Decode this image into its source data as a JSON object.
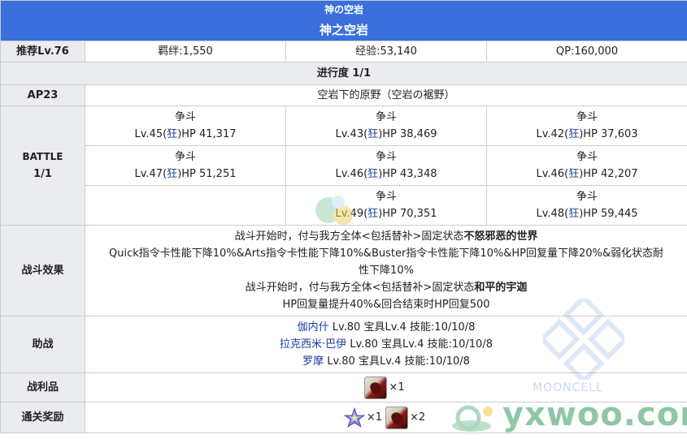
{
  "header": {
    "title_jp": "神の空岩",
    "title_cn": "神之空岩"
  },
  "recommend": {
    "level": "推荐Lv.76",
    "bond": "羁绊:1,550",
    "exp": "经验:53,140",
    "qp": "QP:160,000"
  },
  "progress": "进行度 1/1",
  "ap": {
    "label": "AP23",
    "location": "空岩下的原野（空岩の裾野）"
  },
  "battle": {
    "label_line1": "BATTLE",
    "label_line2": "1/1",
    "rows": [
      [
        {
          "name": "争斗",
          "lv": "Lv.45(",
          "cls": "狂",
          "hp": ")HP 41,317"
        },
        {
          "name": "争斗",
          "lv": "Lv.43(",
          "cls": "狂",
          "hp": ")HP 38,469"
        },
        {
          "name": "争斗",
          "lv": "Lv.42(",
          "cls": "狂",
          "hp": ")HP 37,603"
        }
      ],
      [
        {
          "name": "争斗",
          "lv": "Lv.47(",
          "cls": "狂",
          "hp": ")HP 51,251"
        },
        {
          "name": "争斗",
          "lv": "Lv.46(",
          "cls": "狂",
          "hp": ")HP 43,348"
        },
        {
          "name": "争斗",
          "lv": "Lv.46(",
          "cls": "狂",
          "hp": ")HP 42,207"
        }
      ],
      [
        {
          "name": "争斗",
          "lv": "Lv.49(",
          "cls": "狂",
          "hp": ")HP 70,351"
        },
        {
          "name": "争斗",
          "lv": "Lv.48(",
          "cls": "狂",
          "hp": ")HP 59,445"
        }
      ]
    ]
  },
  "effects": {
    "label": "战斗效果",
    "line1_pre": "战斗开始时，付与我方全体<包括替补>固定状态",
    "line1_bold": "不怒邪恶的世界",
    "line2": "Quick指令卡性能下降10%&Arts指令卡性能下降10%&Buster指令卡性能下降10%&HP回复量下降20%&弱化状态耐",
    "line3": "性下降10%",
    "line4_pre": "战斗开始时，付与我方全体<包括替补>固定状态",
    "line4_bold": "和平的宇迦",
    "line5": "HP回复量提升40%&回合结束时HP回复500"
  },
  "support": {
    "label": "助战",
    "items": [
      {
        "name": "伽内什",
        "detail": " Lv.80 宝具Lv.4 技能:10/10/8"
      },
      {
        "name": "拉克西米·巴伊",
        "detail": " Lv.80 宝具Lv.4 技能:10/10/8"
      },
      {
        "name": "罗摩",
        "detail": " Lv.80 宝具Lv.4 技能:10/10/8"
      }
    ]
  },
  "loot": {
    "label": "战利品",
    "qty": "×1"
  },
  "clear_reward": {
    "label": "通关奖励",
    "qty1": "×1",
    "qty2": "×2"
  },
  "watermarks": {
    "mooncell": "MOONCELL",
    "yxwoo": "yxwoo.com"
  },
  "colors": {
    "header_blue": "#3a6fdc",
    "label_bg": "#eaecf0",
    "link": "#1a3c9e",
    "border": "#c8cdd6"
  }
}
